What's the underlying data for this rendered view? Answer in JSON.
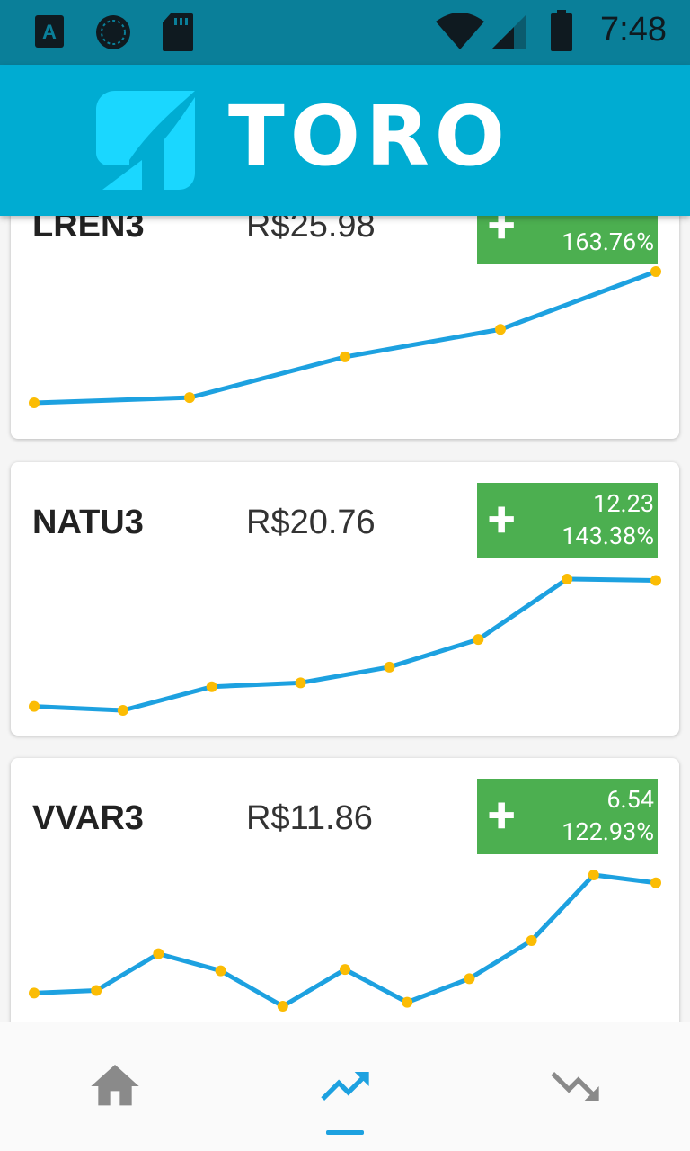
{
  "status_bar": {
    "time": "7:48",
    "icons": [
      "a-notification-icon",
      "sync-icon",
      "sd-card-icon",
      "wifi-icon",
      "signal-icon",
      "battery-icon"
    ]
  },
  "app_bar": {
    "brand": "TORO",
    "logo_icon": "toro-logo-icon"
  },
  "colors": {
    "status_bar": "#0a7f99",
    "app_bar": "#00acd2",
    "logo_accent": "#1ad7ff",
    "positive_badge": "#4caf50",
    "line": "#1da1e0",
    "point": "#fbbc04",
    "nav_active": "#1da1e0",
    "nav_inactive": "#8a8a8a"
  },
  "stocks": [
    {
      "ticker": "LREN3",
      "price": "R$25.98",
      "sign": "+",
      "change": "",
      "percent": "163.76%",
      "series": [
        0,
        0.04,
        0.35,
        0.56,
        1.0
      ]
    },
    {
      "ticker": "NATU3",
      "price": "R$20.76",
      "sign": "+",
      "change": "12.23",
      "percent": "143.38%",
      "series": [
        0.03,
        0.0,
        0.18,
        0.21,
        0.33,
        0.54,
        1.0,
        0.99
      ]
    },
    {
      "ticker": "VVAR3",
      "price": "R$11.86",
      "sign": "+",
      "change": "6.54",
      "percent": "122.93%",
      "series": [
        0.1,
        0.12,
        0.4,
        0.27,
        0.0,
        0.28,
        0.03,
        0.21,
        0.5,
        1.0,
        0.94
      ]
    }
  ],
  "bottom_nav": {
    "items": [
      {
        "name": "home",
        "icon": "home-icon",
        "active": false
      },
      {
        "name": "trending-up",
        "icon": "trending-up-icon",
        "active": true
      },
      {
        "name": "trending-down",
        "icon": "trending-down-icon",
        "active": false
      }
    ]
  }
}
